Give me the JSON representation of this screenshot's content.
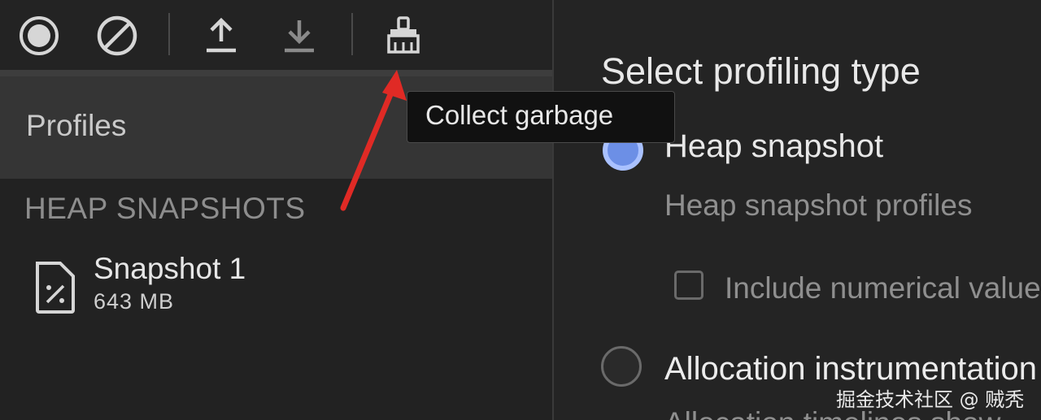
{
  "toolbar": {
    "buttons": [
      {
        "name": "record-icon",
        "tooltip": ""
      },
      {
        "name": "clear-icon",
        "tooltip": ""
      },
      {
        "name": "upload-icon",
        "tooltip": ""
      },
      {
        "name": "download-icon",
        "tooltip": ""
      },
      {
        "name": "broom-icon",
        "tooltip": "Collect garbage"
      }
    ]
  },
  "tooltip": {
    "text": "Collect garbage"
  },
  "sidebar": {
    "profiles_label": "Profiles",
    "section_label": "HEAP SNAPSHOTS",
    "snapshots": [
      {
        "title": "Snapshot 1",
        "size": "643 MB",
        "icon": "snapshot-file-icon"
      }
    ]
  },
  "main": {
    "title": "Select profiling type",
    "options": [
      {
        "label": "Heap snapshot",
        "description": "Heap snapshot profiles",
        "selected": true
      },
      {
        "label": "Allocation instrumentation",
        "description": "Allocation timelines show",
        "selected": false
      }
    ],
    "checkbox_label": "Include numerical values"
  },
  "watermark": "掘金技术社区 @ 贼秃",
  "colors": {
    "accent": "#6c8fe6",
    "annotation_arrow": "#e02a25",
    "tooltip_bg": "#111111"
  }
}
